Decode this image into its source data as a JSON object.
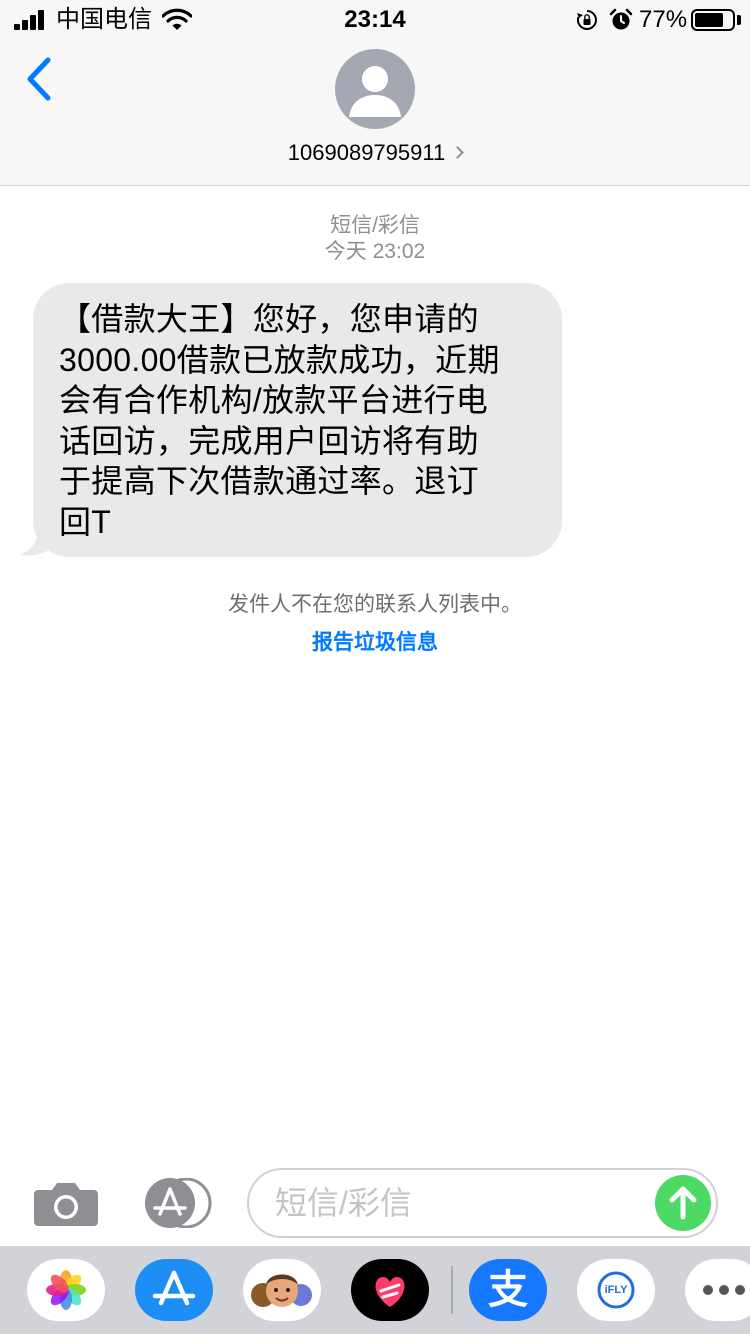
{
  "status_bar": {
    "carrier": "中国电信",
    "time": "23:14",
    "battery_percent": "77%",
    "battery_level": 0.77,
    "icons": [
      "signal-icon",
      "wifi-icon",
      "orientation-lock-icon",
      "alarm-icon",
      "battery-icon"
    ]
  },
  "header": {
    "contact_number": "1069089795911",
    "back_icon": "chevron-left-icon",
    "avatar_icon": "person-silhouette-icon"
  },
  "conversation": {
    "message_type": "短信/彩信",
    "timestamp": "今天 23:02",
    "messages": [
      {
        "direction": "incoming",
        "text": "【借款大王】您好，您申请的\n3000.00借款已放款成功，近期\n会有合作机构/放款平台进行电\n话回访，完成用户回访将有助\n于提高下次借款通过率。退订\n回T"
      }
    ],
    "not_in_contacts": "发件人不在您的联系人列表中。",
    "report_junk": "报告垃圾信息"
  },
  "input_bar": {
    "placeholder": "短信/彩信",
    "camera_icon": "camera-icon",
    "apps_icon": "app-store-icon",
    "send_icon": "arrow-up-icon"
  },
  "app_drawer": {
    "apps": [
      "photos-icon",
      "app-store-icon",
      "memoji-icon",
      "heart-sticker-icon",
      "alipay-icon",
      "ifly-icon",
      "more-icon"
    ],
    "ifly_label": "iFLY",
    "alipay_glyph": "支"
  },
  "colors": {
    "accent_blue": "#007aff",
    "bubble_gray": "#e9e9eb",
    "send_green": "#4cd964",
    "bar_background": "#f7f7f7",
    "drawer_background": "#d1d3d9"
  }
}
